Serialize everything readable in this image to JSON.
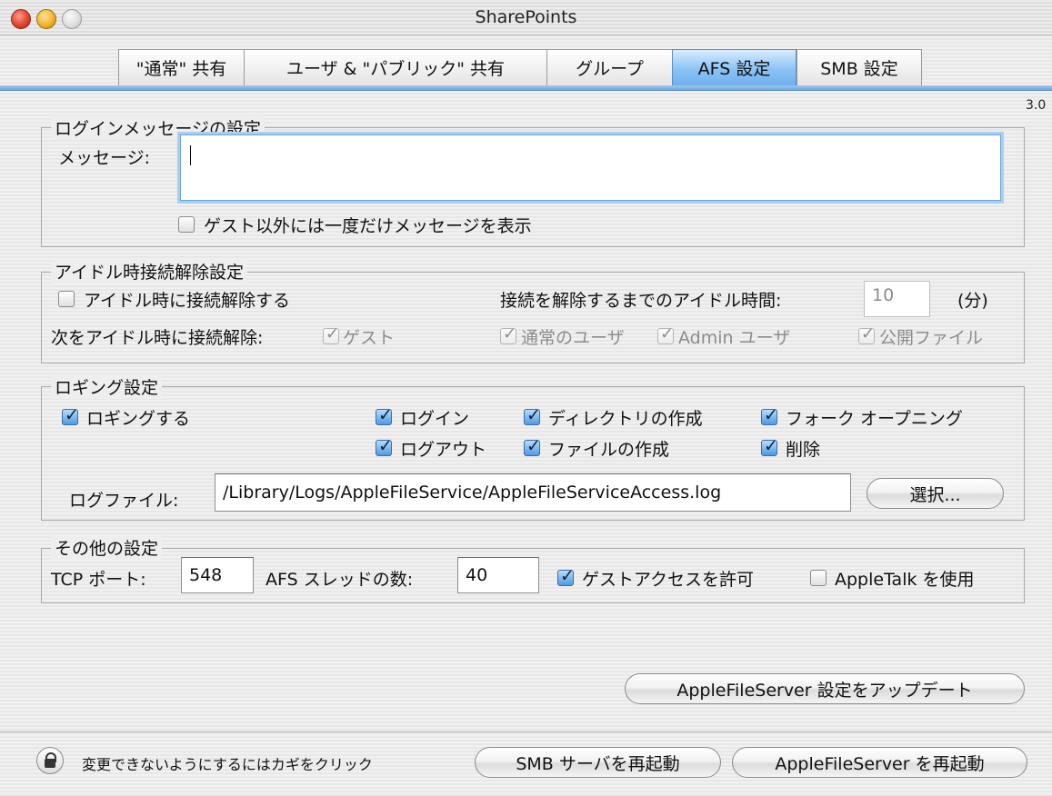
{
  "window": {
    "title": "SharePoints",
    "version": "3.0"
  },
  "tabs": [
    {
      "label": "\"通常\" 共有",
      "active": false
    },
    {
      "label": "ユーザ & \"パブリック\" 共有",
      "active": false
    },
    {
      "label": "グループ",
      "active": false
    },
    {
      "label": "AFS 設定",
      "active": true
    },
    {
      "label": "SMB 設定",
      "active": false
    }
  ],
  "login_message": {
    "legend": "ログインメッセージの設定",
    "message_label": "メッセージ:",
    "message_value": "",
    "show_once_label": "ゲスト以外には一度だけメッセージを表示",
    "show_once_checked": false
  },
  "idle": {
    "legend": "アイドル時接続解除設定",
    "disconnect_label": "アイドル時に接続解除する",
    "disconnect_checked": false,
    "idle_time_label": "接続を解除するまでのアイドル時間:",
    "idle_time_value": "10",
    "idle_time_unit": "(分)",
    "targets_label": "次をアイドル時に接続解除:",
    "guest_label": "ゲスト",
    "normal_user_label": "通常のユーザ",
    "admin_user_label": "Admin ユーザ",
    "public_file_label": "公開ファイル"
  },
  "logging": {
    "legend": "ロギング設定",
    "enable_label": "ロギングする",
    "login_label": "ログイン",
    "mkdir_label": "ディレクトリの作成",
    "fork_open_label": "フォーク オープニング",
    "logout_label": "ログアウト",
    "mkfile_label": "ファイルの作成",
    "delete_label": "削除",
    "logfile_label": "ログファイル:",
    "logfile_path": "/Library/Logs/AppleFileService/AppleFileServiceAccess.log",
    "choose_button": "選択..."
  },
  "other": {
    "legend": "その他の設定",
    "tcp_port_label": "TCP ポート:",
    "tcp_port_value": "548",
    "afs_threads_label": "AFS スレッドの数:",
    "afs_threads_value": "40",
    "guest_access_label": "ゲストアクセスを許可",
    "guest_access_checked": true,
    "appletalk_label": "AppleTalk を使用",
    "appletalk_checked": false
  },
  "actions": {
    "update_button": "AppleFileServer 設定をアップデート",
    "lock_text": "変更できないようにするにはカギをクリック",
    "restart_smb_button": "SMB サーバを再起動",
    "restart_afs_button": "AppleFileServer を再起動"
  }
}
